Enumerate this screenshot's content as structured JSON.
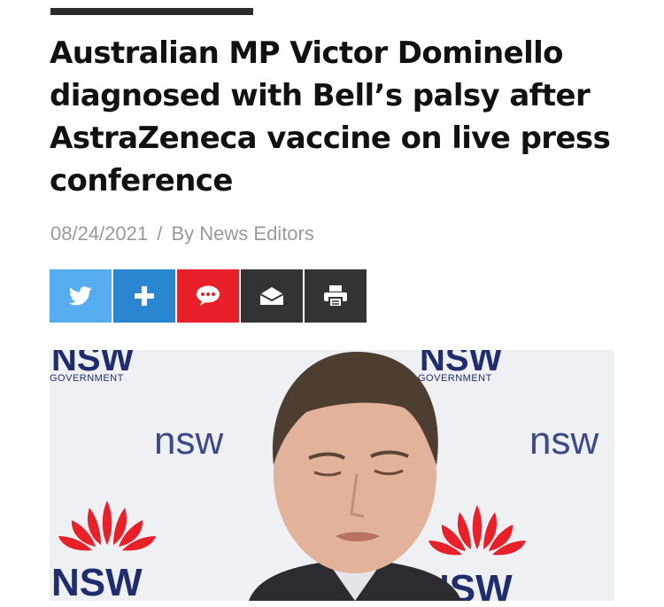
{
  "article": {
    "headline": "Australian MP Victor Dominello diagnosed with Bell’s palsy after AstraZeneca vaccine on live press conference",
    "date": "08/24/2021",
    "separator": "/",
    "author": "By News Editors"
  },
  "share_buttons": [
    {
      "name": "twitter",
      "icon": "twitter-bird-icon",
      "color": "#55acee"
    },
    {
      "name": "share-more",
      "icon": "plus-icon",
      "color": "#2a86d0"
    },
    {
      "name": "comment",
      "icon": "speech-bubble-icon",
      "color": "#e8202a"
    },
    {
      "name": "email",
      "icon": "envelope-icon",
      "color": "#333333"
    },
    {
      "name": "print",
      "icon": "printer-icon",
      "color": "#333333"
    }
  ],
  "hero_image": {
    "backdrop_text_large": "NSW",
    "backdrop_text_small": "GOVERNMENT",
    "backdrop_text_mid": "nsw",
    "logo_color": "#e8202a",
    "brand_color": "#1f2d6e"
  }
}
